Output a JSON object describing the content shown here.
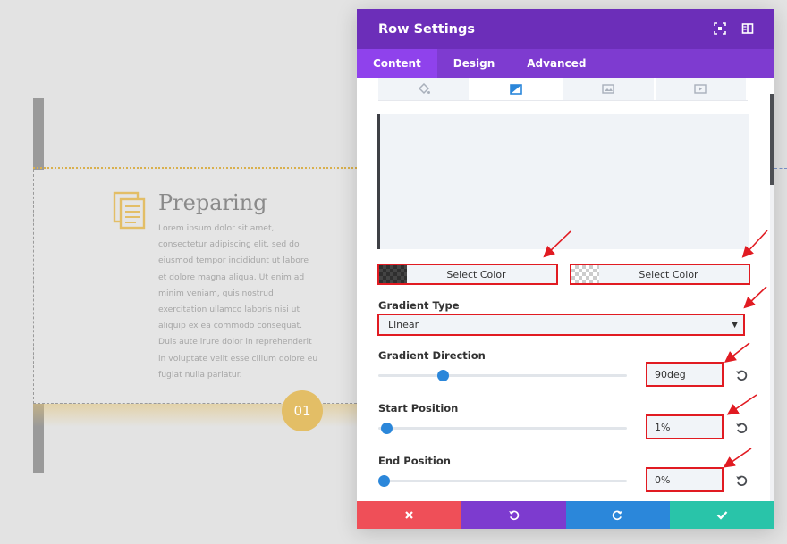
{
  "background": {
    "title": "Preparing",
    "text": "Lorem ipsum dolor sit amet, consectetur adipiscing elit, sed do eiusmod tempor incididunt ut labore et dolore magna aliqua. Ut enim ad minim veniam, quis nostrud exercitation ullamco laboris nisi ut aliquip ex ea commodo consequat. Duis aute irure dolor in reprehenderit in voluptate velit esse cillum dolore eu fugiat nulla pariatur.",
    "badge": "01",
    "accent": "#e3be66"
  },
  "panel": {
    "title": "Row Settings",
    "header_icons": [
      "fullscreen-icon",
      "sidebar-icon"
    ],
    "tabs": [
      {
        "label": "Content",
        "active": true
      },
      {
        "label": "Design",
        "active": false
      },
      {
        "label": "Advanced",
        "active": false
      }
    ],
    "bg_subtabs": [
      "paint-bucket-icon",
      "gradient-icon",
      "image-icon",
      "video-icon"
    ],
    "active_subtab": "gradient-icon",
    "color_stops": {
      "start_label": "Select Color",
      "end_label": "Select Color"
    },
    "gradient_type": {
      "label": "Gradient Type",
      "value": "Linear"
    },
    "gradient_direction": {
      "label": "Gradient Direction",
      "value": "90deg",
      "fraction": 0.25
    },
    "start_position": {
      "label": "Start Position",
      "value": "1%",
      "fraction": 0.01
    },
    "end_position": {
      "label": "End Position",
      "value": "0%",
      "fraction": 0
    },
    "footer": {
      "colors": [
        "#ef4f58",
        "#7d3bcf",
        "#2b87da",
        "#29c4a9"
      ],
      "icons": [
        "close-icon",
        "undo-icon",
        "redo-icon",
        "check-icon"
      ]
    },
    "colors": {
      "header": "#6c2eb9",
      "tabs": "#7e3bd0",
      "active_tab": "#8f42ec",
      "highlight": "#e11b22",
      "slider": "#2b87da"
    }
  }
}
